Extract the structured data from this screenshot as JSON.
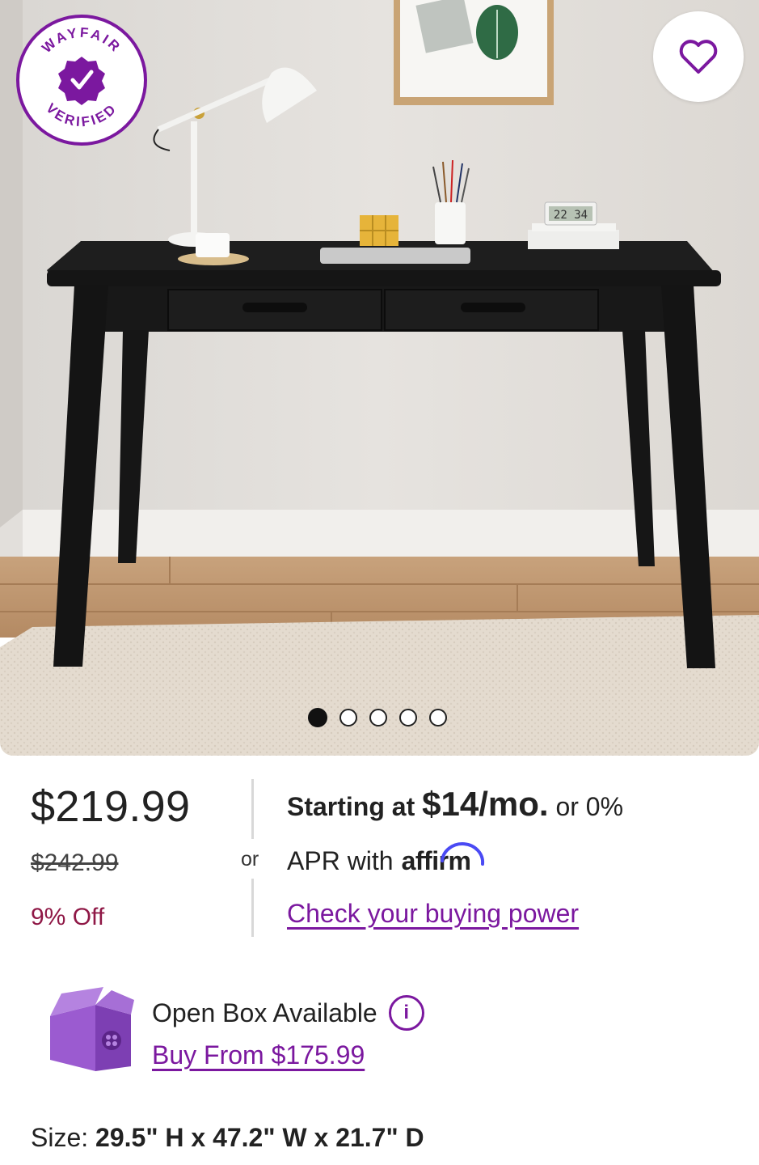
{
  "product": {
    "image_alt": "Black wooden writing desk with two drawers",
    "badge": {
      "top_text": "WAYFAIR",
      "bottom_text": "VERIFIED"
    },
    "gallery": {
      "total_images": 5,
      "active_index": 0
    }
  },
  "pricing": {
    "current_price": "$219.99",
    "original_price": "$242.99",
    "discount": "9% Off",
    "or_label": "or"
  },
  "financing": {
    "starting_at": "Starting at",
    "monthly_amount": "$14/mo.",
    "or_zero": "or 0%",
    "apr_with": "APR with",
    "provider": "affirm",
    "link": "Check your buying power"
  },
  "open_box": {
    "title": "Open Box Available",
    "info_icon": "info-icon",
    "link": "Buy From $175.99"
  },
  "size": {
    "label": "Size:",
    "value": "29.5\" H x 47.2\" W x 21.7\" D"
  },
  "colors": {
    "brand_purple": "#7b189f",
    "discount_red": "#8f1846"
  },
  "icons": [
    "wayfair-verified-badge",
    "heart-icon",
    "open-box-icon",
    "info-icon"
  ]
}
